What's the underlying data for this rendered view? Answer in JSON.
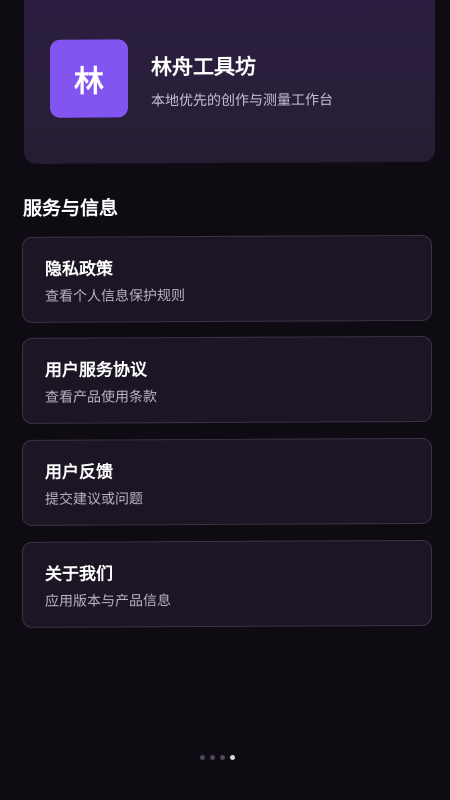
{
  "app": {
    "icon_text": "林",
    "name": "林舟工具坊",
    "tagline": "本地优先的创作与测量工作台"
  },
  "section": {
    "title": "服务与信息"
  },
  "menu": {
    "items": [
      {
        "title": "隐私政策",
        "subtitle": "查看个人信息保护规则"
      },
      {
        "title": "用户服务协议",
        "subtitle": "查看产品使用条款"
      },
      {
        "title": "用户反馈",
        "subtitle": "提交建议或问题"
      },
      {
        "title": "关于我们",
        "subtitle": "应用版本与产品信息"
      }
    ]
  },
  "pager": {
    "count": 4,
    "active_index": 3
  },
  "colors": {
    "background": "#0f0b13",
    "header_card": "#2a1f3b",
    "accent": "#8355f0",
    "card": "#1c1524",
    "card_border": "#3a3245"
  }
}
